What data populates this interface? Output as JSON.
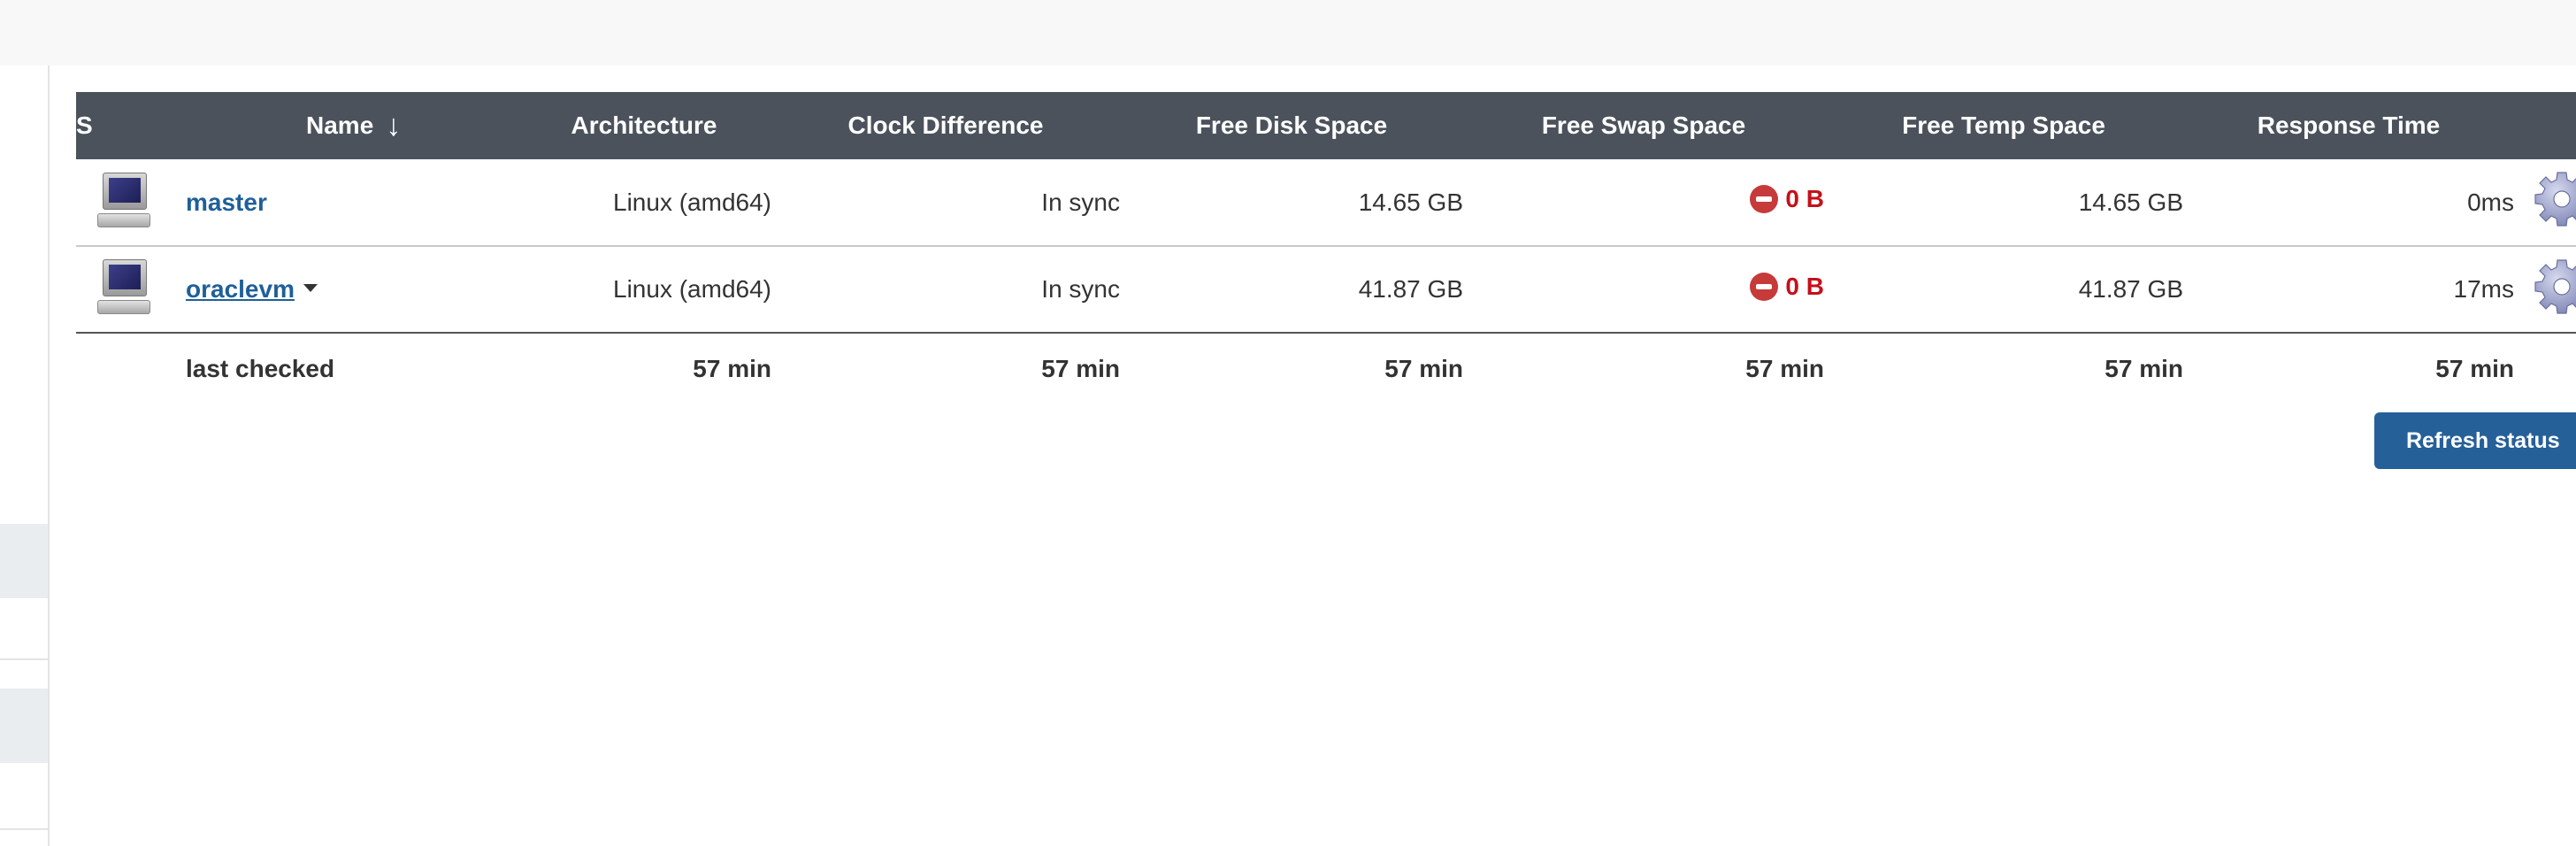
{
  "table": {
    "headers": {
      "s": "S",
      "name": "Name",
      "sort_indicator": "↓",
      "architecture": "Architecture",
      "clock_difference": "Clock Difference",
      "free_disk_space": "Free Disk Space",
      "free_swap_space": "Free Swap Space",
      "free_temp_space": "Free Temp Space",
      "response_time": "Response Time"
    },
    "rows": [
      {
        "icon": "computer-icon",
        "name": "master",
        "architecture": "Linux (amd64)",
        "clock_difference": "In sync",
        "free_disk_space": "14.65 GB",
        "free_swap_space": "0 B",
        "free_temp_space": "14.65 GB",
        "response_time": "0ms"
      },
      {
        "icon": "computer-icon",
        "name": "oraclevm",
        "architecture": "Linux (amd64)",
        "clock_difference": "In sync",
        "free_disk_space": "41.87 GB",
        "free_swap_space": "0 B",
        "free_temp_space": "41.87 GB",
        "response_time": "17ms"
      }
    ],
    "footer": {
      "label": "last checked",
      "architecture": "57 min",
      "clock_difference": "57 min",
      "free_disk_space": "57 min",
      "free_swap_space": "57 min",
      "free_temp_space": "57 min",
      "response_time": "57 min"
    }
  },
  "actions": {
    "refresh_label": "Refresh status"
  },
  "colors": {
    "header_bg": "#4b525b",
    "link": "#1f5f99",
    "error": "#c4111b",
    "button_bg": "#266098"
  }
}
